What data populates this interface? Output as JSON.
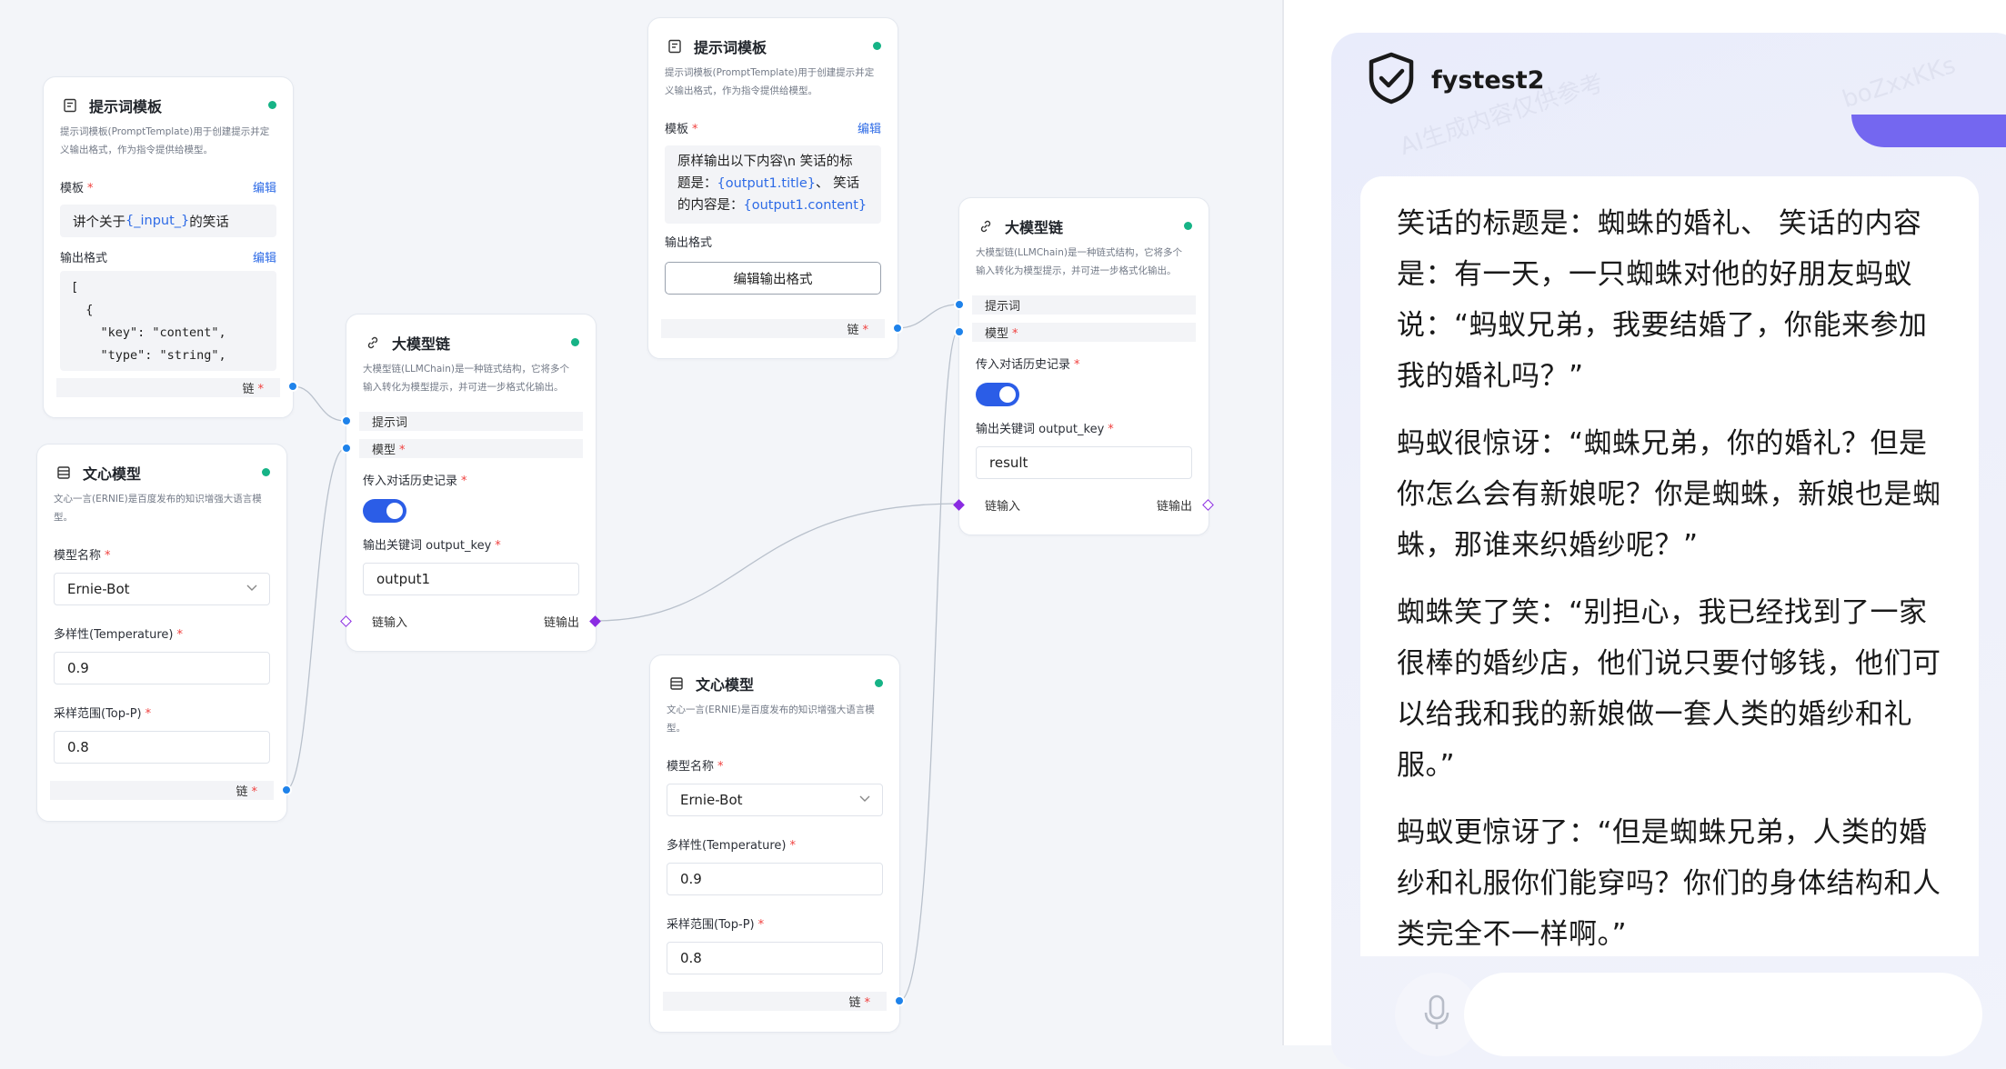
{
  "nodes": {
    "prompt_a": {
      "title": "提示词模板",
      "desc": "提示词模板(PromptTemplate)用于创建提示并定义输出格式，作为指令提供给模型。",
      "template_label": "模板",
      "edit_label": "编辑",
      "template_prefix": "讲个关于 ",
      "template_token": "{_input_}",
      "template_suffix": " 的笑话",
      "output_format_label": "输出格式",
      "output_format_edit": "编辑",
      "code_line1": "[",
      "code_line2": "  {",
      "code_line3": "    \"key\": \"content\",",
      "code_line4": "    \"type\": \"string\",",
      "chain_port": "链"
    },
    "llm_a": {
      "title": "文心模型",
      "desc": "文心一言(ERNIE)是百度发布的知识增强大语言模型。",
      "model_name_label": "模型名称",
      "model_name_value": "Ernie-Bot",
      "temperature_label": "多样性(Temperature)",
      "temperature_value": "0.9",
      "top_p_label": "采样范围(Top-P)",
      "top_p_value": "0.8",
      "chain_port": "链"
    },
    "chain_a": {
      "title": "大模型链",
      "desc": "大模型链(LLMChain)是一种链式结构，它将多个输入转化为模型提示，并可进一步格式化输出。",
      "port_prompt": "提示词",
      "port_model": "模型",
      "history_label": "传入对话历史记录",
      "history_on": true,
      "output_key_label": "输出关键词 output_key",
      "output_key_value": "output1",
      "chain_in": "链输入",
      "chain_out": "链输出"
    },
    "prompt_b": {
      "title": "提示词模板",
      "desc": "提示词模板(PromptTemplate)用于创建提示并定义输出格式，作为指令提供给模型。",
      "template_label": "模板",
      "edit_label": "编辑",
      "t1": "原样输出以下内容\\n 笑话的标",
      "t2a": "题是：",
      "t2tok": "{output1.title}",
      "t2b": "、 笑话",
      "t3a": "的内容是：",
      "t3tok": "{output1.content}",
      "output_format_label": "输出格式",
      "edit_output_button": "编辑输出格式",
      "chain_port": "链"
    },
    "llm_b": {
      "title": "文心模型",
      "desc": "文心一言(ERNIE)是百度发布的知识增强大语言模型。",
      "model_name_label": "模型名称",
      "model_name_value": "Ernie-Bot",
      "temperature_label": "多样性(Temperature)",
      "temperature_value": "0.9",
      "top_p_label": "采样范围(Top-P)",
      "top_p_value": "0.8",
      "chain_port": "链"
    },
    "chain_b": {
      "title": "大模型链",
      "desc": "大模型链(LLMChain)是一种链式结构，它将多个输入转化为模型提示，并可进一步格式化输出。",
      "port_prompt": "提示词",
      "port_model": "模型",
      "history_label": "传入对话历史记录",
      "history_on": true,
      "output_key_label": "输出关键词 output_key",
      "output_key_value": "result",
      "chain_in": "链输入",
      "chain_out": "链输出"
    }
  },
  "chat": {
    "bot_name": "fystest2",
    "watermark": "AI生成内容仅供参考",
    "watermark_id": "boZxxKKs",
    "messages": [
      "笑话的标题是：蜘蛛的婚礼、 笑话的内容是：有一天，一只蜘蛛对他的好朋友蚂蚁说：“蚂蚁兄弟，我要结婚了，你能来参加我的婚礼吗？”",
      "蚂蚁很惊讶：“蜘蛛兄弟，你的婚礼？但是你怎么会有新娘呢？你是蜘蛛，新娘也是蜘蛛，那谁来织婚纱呢？”",
      "蜘蛛笑了笑：“别担心，我已经找到了一家很棒的婚纱店，他们说只要付够钱，他们可以给我和我的新娘做一套人类的婚纱和礼服。”",
      "蚂蚁更惊讶了：“但是蜘蛛兄弟，人类的婚纱和礼服你们能穿吗？你们的身体结构和人类完全不一样啊。”"
    ]
  },
  "colors": {
    "accent": "#2b5de7",
    "link": "#2e6be6",
    "status_dot": "#16b386",
    "port_blue": "#1e82ea",
    "port_purple": "#8a2be2",
    "user_bubble": "#7467f0"
  }
}
